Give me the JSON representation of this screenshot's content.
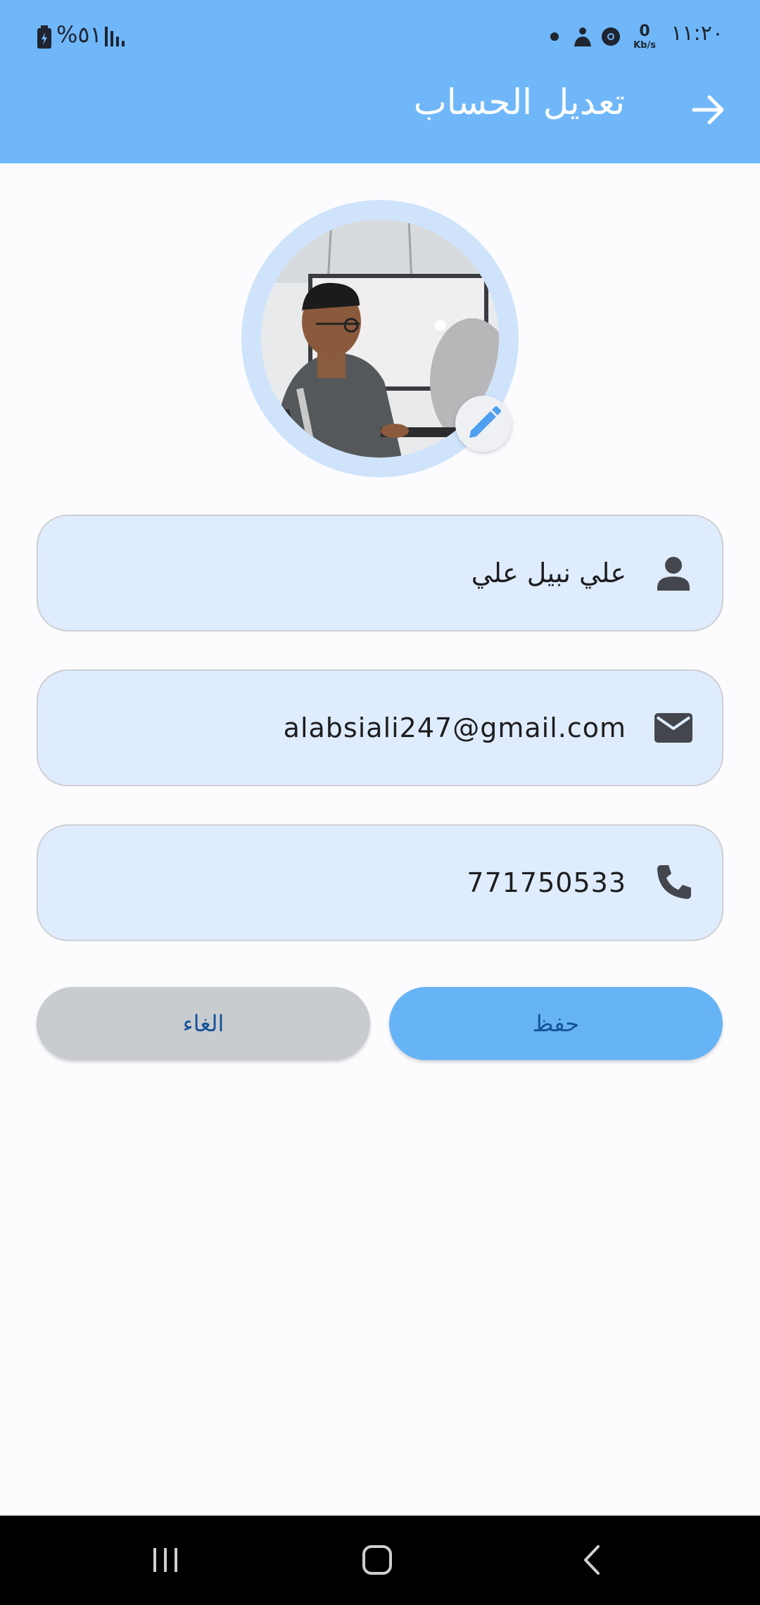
{
  "status_bar": {
    "time": "١١:٢٠",
    "net_speed_value": "0",
    "net_speed_unit": "Kb/s",
    "battery_percent": "%٥١"
  },
  "header": {
    "title": "تعديل الحساب",
    "back_icon": "arrow-right-icon",
    "background_color": "#6fb7f9"
  },
  "profile": {
    "avatar_alt": "صورة الحساب",
    "edit_icon": "pencil-icon"
  },
  "form": {
    "name": {
      "value": "علي نبيل علي",
      "icon": "person-icon"
    },
    "email": {
      "value": "alabsiali247@gmail.com",
      "icon": "mail-icon"
    },
    "phone": {
      "value": "771750533",
      "icon": "phone-icon"
    }
  },
  "actions": {
    "save_label": "حفظ",
    "cancel_label": "الغاء",
    "save_color": "#66b4f6",
    "cancel_color": "#c9cccf"
  },
  "nav": {
    "recent_icon": "recent-apps-icon",
    "home_icon": "home-icon",
    "back_icon": "back-chevron-icon"
  }
}
